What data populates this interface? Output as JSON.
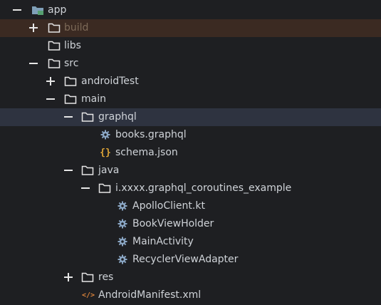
{
  "tree": {
    "items": [
      {
        "label": "app",
        "icon": "module-folder-icon",
        "toggle": "collapse",
        "state": "normal"
      },
      {
        "label": "build",
        "icon": "folder-icon",
        "toggle": "expand",
        "state": "excluded"
      },
      {
        "label": "libs",
        "icon": "folder-icon",
        "toggle": "none",
        "state": "normal"
      },
      {
        "label": "src",
        "icon": "folder-icon",
        "toggle": "collapse",
        "state": "normal"
      },
      {
        "label": "androidTest",
        "icon": "folder-icon",
        "toggle": "expand",
        "state": "normal"
      },
      {
        "label": "main",
        "icon": "folder-icon",
        "toggle": "collapse",
        "state": "normal"
      },
      {
        "label": "graphql",
        "icon": "folder-icon",
        "toggle": "collapse",
        "state": "selected"
      },
      {
        "label": "books.graphql",
        "icon": "gear-file-icon",
        "toggle": "none",
        "state": "normal"
      },
      {
        "label": "schema.json",
        "icon": "json-braces-icon",
        "toggle": "none",
        "state": "normal"
      },
      {
        "label": "java",
        "icon": "folder-icon",
        "toggle": "collapse",
        "state": "normal"
      },
      {
        "label": "i.xxxx.graphql_coroutines_example",
        "icon": "folder-icon",
        "toggle": "collapse",
        "state": "normal"
      },
      {
        "label": "ApolloClient.kt",
        "icon": "gear-file-icon",
        "toggle": "none",
        "state": "normal"
      },
      {
        "label": "BookViewHolder",
        "icon": "gear-file-icon",
        "toggle": "none",
        "state": "normal"
      },
      {
        "label": "MainActivity",
        "icon": "gear-file-icon",
        "toggle": "none",
        "state": "normal"
      },
      {
        "label": "RecyclerViewAdapter",
        "icon": "gear-file-icon",
        "toggle": "none",
        "state": "normal"
      },
      {
        "label": "res",
        "icon": "folder-icon",
        "toggle": "expand",
        "state": "normal"
      },
      {
        "label": "AndroidManifest.xml",
        "icon": "xml-code-icon",
        "toggle": "none",
        "state": "normal"
      }
    ]
  },
  "colors": {
    "background": "#1e1f22",
    "selected_row": "#2e3340",
    "excluded_row": "#3b2a22",
    "text": "#cfd3d8",
    "excluded_text": "#7d6a58",
    "gear_icon": "#8aa6c4",
    "json_icon": "#e0a637",
    "xml_icon": "#d9823b",
    "folder_stroke": "#e6e6e6",
    "module_folder": "#7fa0b8"
  }
}
